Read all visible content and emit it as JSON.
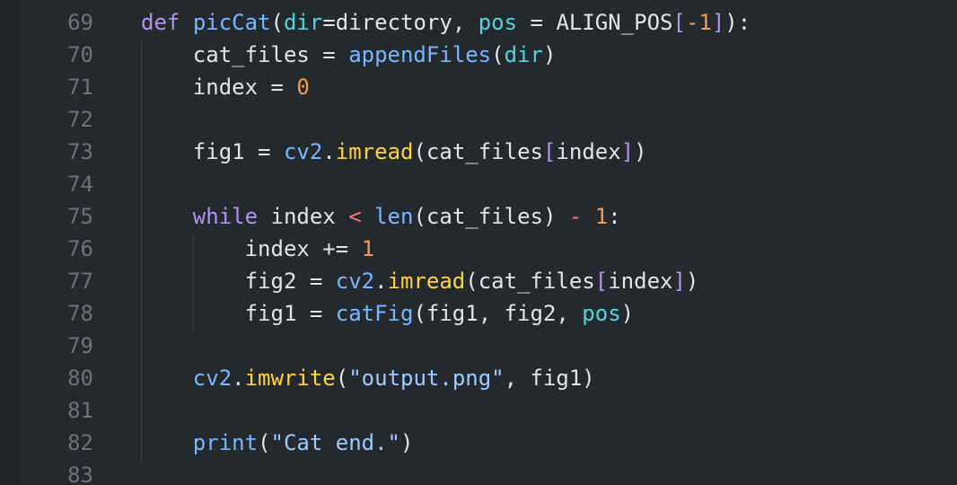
{
  "editor": {
    "colors": {
      "background": "#24292e",
      "line_number": "#6a737d",
      "text": "#e1e4e8",
      "keyword": "#b392f0",
      "function": "#79b8ff",
      "method": "#ffd33d",
      "number": "#f29b52",
      "string": "#9ecbff"
    },
    "lines": [
      {
        "n": "69",
        "indent": "",
        "tokens": [
          [
            "def",
            "kw"
          ],
          [
            " ",
            "txt"
          ],
          [
            "picCat",
            "fn"
          ],
          [
            "(",
            "txt"
          ],
          [
            "dir",
            "teal"
          ],
          [
            "=",
            "txt"
          ],
          [
            "directory, ",
            "txt"
          ],
          [
            "pos",
            "teal"
          ],
          [
            " = ALIGN_POS",
            "txt"
          ],
          [
            "[",
            "br"
          ],
          [
            "-1",
            "num"
          ],
          [
            "]",
            "br"
          ],
          [
            "):",
            "txt"
          ]
        ]
      },
      {
        "n": "70",
        "indent": "    ",
        "tokens": [
          [
            "cat_files = ",
            "txt"
          ],
          [
            "appendFiles",
            "fn"
          ],
          [
            "(",
            "txt"
          ],
          [
            "dir",
            "teal"
          ],
          [
            ")",
            "txt"
          ]
        ]
      },
      {
        "n": "71",
        "indent": "    ",
        "tokens": [
          [
            "index = ",
            "txt"
          ],
          [
            "0",
            "num"
          ]
        ]
      },
      {
        "n": "72",
        "indent": "",
        "tokens": []
      },
      {
        "n": "73",
        "indent": "    ",
        "tokens": [
          [
            "fig1 = ",
            "txt"
          ],
          [
            "cv2",
            "fn"
          ],
          [
            ".",
            "txt"
          ],
          [
            "imread",
            "yl"
          ],
          [
            "(",
            "txt"
          ],
          [
            "cat_files",
            "txt"
          ],
          [
            "[",
            "br"
          ],
          [
            "index",
            "txt"
          ],
          [
            "]",
            "br"
          ],
          [
            ")",
            "txt"
          ]
        ]
      },
      {
        "n": "74",
        "indent": "",
        "tokens": []
      },
      {
        "n": "75",
        "indent": "    ",
        "tokens": [
          [
            "while",
            "kw"
          ],
          [
            " index ",
            "txt"
          ],
          [
            "<",
            "op"
          ],
          [
            " ",
            "txt"
          ],
          [
            "len",
            "fn"
          ],
          [
            "(cat_files) ",
            "txt"
          ],
          [
            "-",
            "op"
          ],
          [
            " ",
            "txt"
          ],
          [
            "1",
            "num"
          ],
          [
            ":",
            "txt"
          ]
        ]
      },
      {
        "n": "76",
        "indent": "        ",
        "tokens": [
          [
            "index += ",
            "txt"
          ],
          [
            "1",
            "num"
          ]
        ]
      },
      {
        "n": "77",
        "indent": "        ",
        "tokens": [
          [
            "fig2 = ",
            "txt"
          ],
          [
            "cv2",
            "fn"
          ],
          [
            ".",
            "txt"
          ],
          [
            "imread",
            "yl"
          ],
          [
            "(",
            "txt"
          ],
          [
            "cat_files",
            "txt"
          ],
          [
            "[",
            "br"
          ],
          [
            "index",
            "txt"
          ],
          [
            "]",
            "br"
          ],
          [
            ")",
            "txt"
          ]
        ]
      },
      {
        "n": "78",
        "indent": "        ",
        "tokens": [
          [
            "fig1 = ",
            "txt"
          ],
          [
            "catFig",
            "fn"
          ],
          [
            "(fig1, fig2, ",
            "txt"
          ],
          [
            "pos",
            "teal"
          ],
          [
            ")",
            "txt"
          ]
        ]
      },
      {
        "n": "79",
        "indent": "",
        "tokens": []
      },
      {
        "n": "80",
        "indent": "    ",
        "tokens": [
          [
            "cv2",
            "fn"
          ],
          [
            ".",
            "txt"
          ],
          [
            "imwrite",
            "yl"
          ],
          [
            "(",
            "txt"
          ],
          [
            "\"output.png\"",
            "str"
          ],
          [
            ", fig1)",
            "txt"
          ]
        ]
      },
      {
        "n": "81",
        "indent": "",
        "tokens": []
      },
      {
        "n": "82",
        "indent": "    ",
        "tokens": [
          [
            "print",
            "fn"
          ],
          [
            "(",
            "txt"
          ],
          [
            "\"Cat end.\"",
            "str"
          ],
          [
            ")",
            "txt"
          ]
        ]
      },
      {
        "n": "83",
        "indent": "",
        "tokens": []
      }
    ]
  }
}
